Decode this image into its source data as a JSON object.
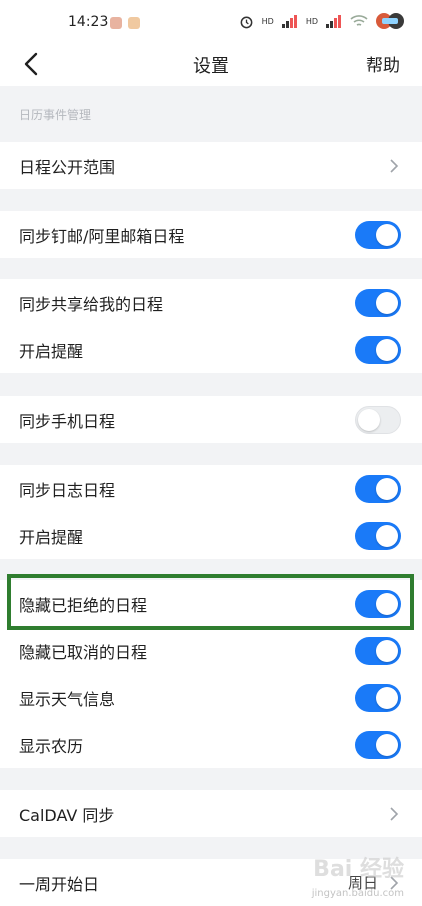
{
  "status_bar": {
    "time": "14:23",
    "hd1": "HD",
    "hd2": "HD"
  },
  "nav": {
    "title": "设置",
    "help": "帮助"
  },
  "section_label": "日历事件管理",
  "groups": {
    "g1": {
      "item0": "日程公开范围"
    },
    "g2": {
      "item0": "同步钉邮/阿里邮箱日程"
    },
    "g3": {
      "item0": "同步共享给我的日程",
      "item1": "开启提醒"
    },
    "g4": {
      "item0": "同步手机日程"
    },
    "g5": {
      "item0": "同步日志日程",
      "item1": "开启提醒"
    },
    "g6": {
      "item0": "隐藏已拒绝的日程",
      "item1": "隐藏已取消的日程",
      "item2": "显示天气信息",
      "item3": "显示农历"
    },
    "g7": {
      "item0": "CalDAV 同步"
    },
    "g8": {
      "item0": "一周开始日",
      "value": "周日"
    }
  },
  "toggles": {
    "sync_dingmail": true,
    "sync_shared": true,
    "shared_reminder": true,
    "sync_phone": false,
    "sync_log": true,
    "log_reminder": true,
    "hide_declined": true,
    "hide_cancelled": true,
    "show_weather": true,
    "show_lunar": true
  },
  "colors": {
    "accent": "#1a7af8",
    "highlight": "#2f7d2f",
    "background": "#f2f3f5"
  },
  "watermark": {
    "text": "Bai 经验",
    "sub": "jingyan.baidu.com"
  }
}
